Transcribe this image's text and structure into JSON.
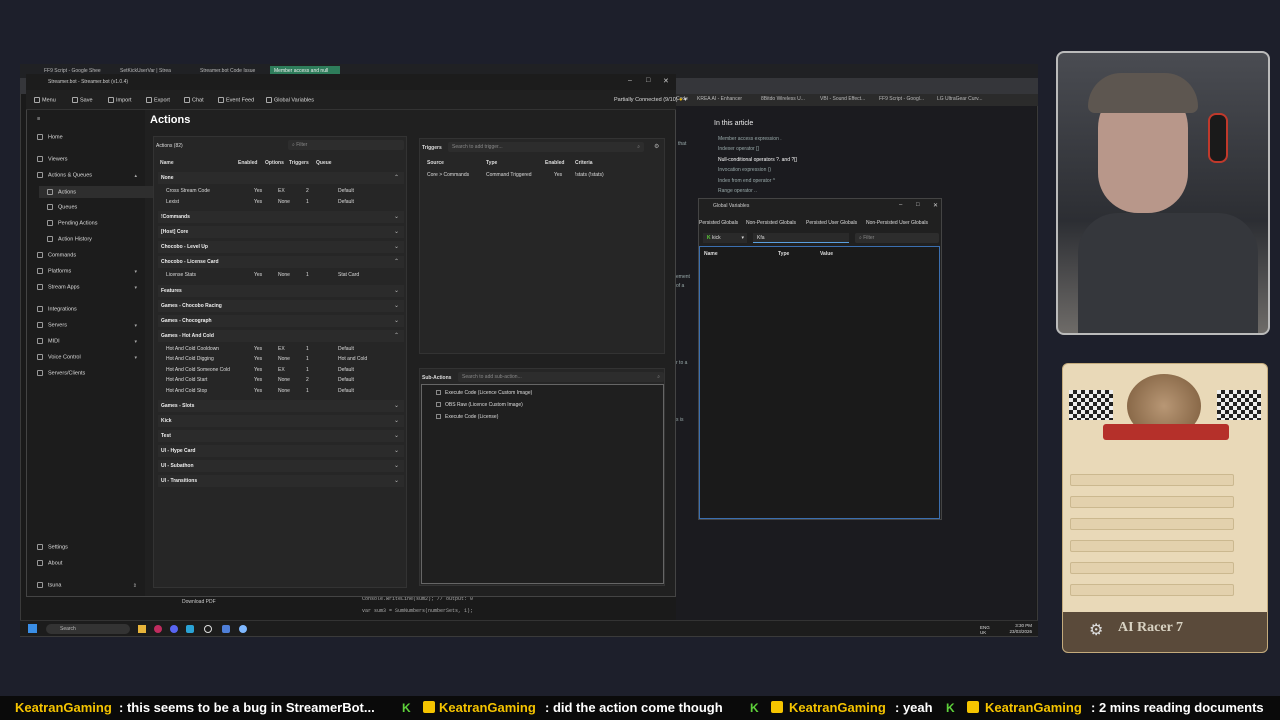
{
  "browser": {
    "tabs": [
      "FF9 Script - Google Shee",
      "SetKickUserVar | Strea",
      "Streamer.bot Code Issue",
      "Member access and null"
    ],
    "bookmarks": [
      "Code",
      "KREA AI - Enhancer",
      "8Bitdo Wireless U...",
      "VBI - Sound Effect...",
      "FF9 Script - Googl...",
      "LG UltraGear Curv..."
    ]
  },
  "article": {
    "heading": "In this article",
    "items": [
      "Member access expression .",
      "Indexer operator []",
      "Null-conditional operators ?. and ?[]",
      "Invocation expression ()",
      "Index from end operator ^",
      "Range operator .."
    ],
    "side_fragments": [
      "that",
      "ement",
      "of a",
      "r to a",
      "s is"
    ]
  },
  "code_lines": [
    "Console.WriteLine(sum2); // output: 0",
    "var sum3 = SumNumbers(numberSets, 1);",
    "Console.WriteLine(sum3); // output: NaN"
  ],
  "streamerbot": {
    "title": "Streamer.bot - Streamer.bot (v1.0.4)",
    "toolbar": [
      "Menu",
      "Save",
      "Import",
      "Export",
      "Chat",
      "Event Feed",
      "Global Variables"
    ],
    "status": "Partially Connected (9/10)",
    "sidebar": {
      "home": "Home",
      "viewers": "Viewers",
      "actions_queues": "Actions & Queues",
      "actions": "Actions",
      "queues": "Queues",
      "pending_actions": "Pending Actions",
      "action_history": "Action History",
      "commands": "Commands",
      "platforms": "Platforms",
      "stream_apps": "Stream Apps",
      "integrations": "Integrations",
      "servers": "Servers",
      "midi": "MIDI",
      "voice_control": "Voice Control",
      "servers_clients": "Servers/Clients",
      "settings": "Settings",
      "about": "About",
      "user": "tsuna",
      "download_pdf": "Download PDF"
    },
    "actions": {
      "title": "Actions",
      "list_label": "Actions (82)",
      "filter_placeholder": "Filter",
      "columns": [
        "Name",
        "Enabled",
        "Options",
        "Triggers",
        "Queue"
      ],
      "groups": [
        {
          "name": "None",
          "rows": [
            [
              "Cross Stream Code",
              "Yes",
              "EX",
              "2",
              "Default"
            ],
            [
              "Lexist",
              "Yes",
              "None",
              "1",
              "Default"
            ]
          ]
        },
        {
          "name": "!Commands",
          "rows": []
        },
        {
          "name": "[Host] Core",
          "rows": []
        },
        {
          "name": "Chocobo - Level Up",
          "rows": []
        },
        {
          "name": "Chocobo - License Card",
          "rows": [
            [
              "License Stats",
              "Yes",
              "None",
              "1",
              "Stat Card"
            ]
          ]
        },
        {
          "name": "Features",
          "rows": []
        },
        {
          "name": "Games - Chocobo Racing",
          "rows": []
        },
        {
          "name": "Games - Chocograph",
          "rows": []
        },
        {
          "name": "Games - Hot And Cold",
          "rows": [
            [
              "Hot And Cold Cooldown",
              "Yes",
              "EX",
              "1",
              "Default"
            ],
            [
              "Hot And Cold Digging",
              "Yes",
              "None",
              "1",
              "Hot and Cold"
            ],
            [
              "Hot And Cold Someone Cold",
              "Yes",
              "EX",
              "1",
              "Default"
            ],
            [
              "Hot And Cold Start",
              "Yes",
              "None",
              "2",
              "Default"
            ],
            [
              "Hot And Cold Stop",
              "Yes",
              "None",
              "1",
              "Default"
            ]
          ]
        },
        {
          "name": "Games - Slots",
          "rows": []
        },
        {
          "name": "Kick",
          "rows": []
        },
        {
          "name": "Test",
          "rows": []
        },
        {
          "name": "UI - Hype Card",
          "rows": []
        },
        {
          "name": "UI - Subathon",
          "rows": []
        },
        {
          "name": "UI - Transitions",
          "rows": []
        }
      ]
    },
    "triggers": {
      "label": "Triggers",
      "search_placeholder": "Search to add trigger...",
      "columns": [
        "Source",
        "Type",
        "Enabled",
        "Criteria"
      ],
      "rows": [
        [
          "Core > Commands",
          "Command Triggered",
          "Yes",
          "!stats (!stats)"
        ]
      ]
    },
    "subactions": {
      "label": "Sub-Actions",
      "search_placeholder": "Search to add sub-action...",
      "items": [
        "Execute Code (Licence Custom Image)",
        "OBS Raw (Licence Custom Image)",
        "Execute Code (License)"
      ]
    }
  },
  "global_variables": {
    "title": "Global Variables",
    "tabs": [
      "Persisted Globals",
      "Non-Persisted Globals",
      "Persisted User Globals",
      "Non-Persisted User Globals"
    ],
    "platform": "kick",
    "user_value": "Kfa",
    "filter_placeholder": "Filter",
    "columns": [
      "Name",
      "Type",
      "Value"
    ]
  },
  "taskbar": {
    "search": "Search",
    "lang": "ENG",
    "region": "UK",
    "time": "3:30 PM",
    "date": "23/03/2026"
  },
  "overlay": {
    "card_name": "AI Racer 7"
  },
  "ticker": [
    {
      "user": "KeatranGaming",
      "msg": ": this seems to be a bug in StreamerBot..."
    },
    {
      "user": "KeatranGaming",
      "msg": ": did the action come though"
    },
    {
      "user": "KeatranGaming",
      "msg": ": yeah"
    },
    {
      "user": "KeatranGaming",
      "msg": ": 2 mins reading documents"
    }
  ]
}
